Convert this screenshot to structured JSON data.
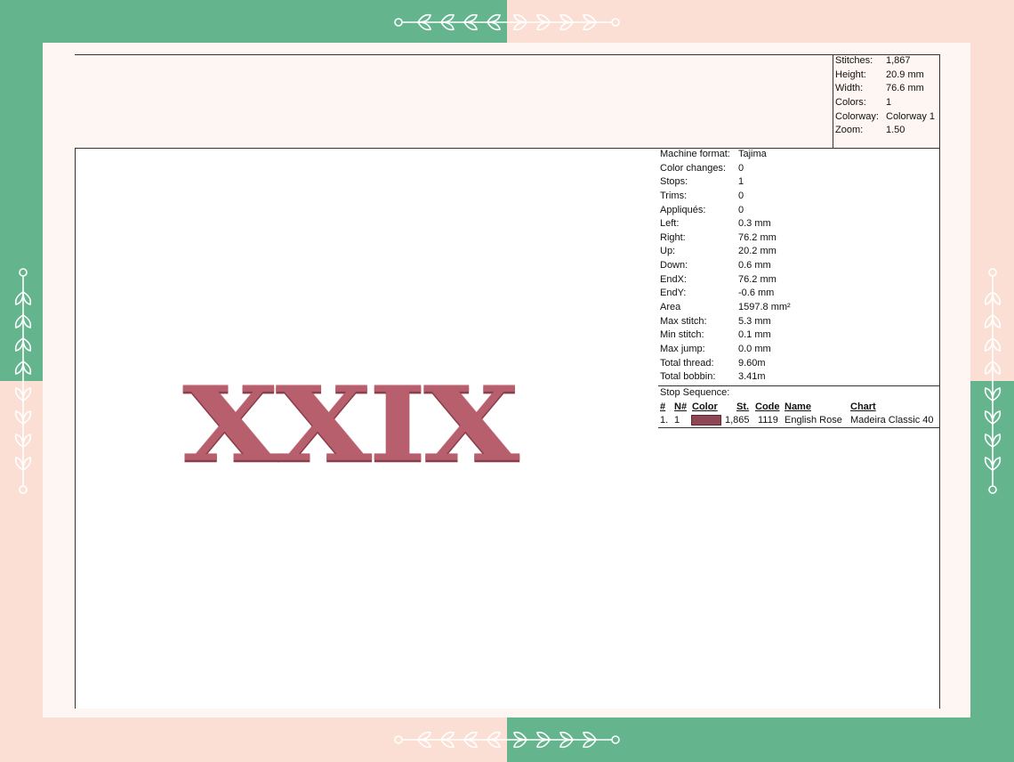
{
  "background_colors": {
    "green": "#64b48e",
    "peach": "#fbdfd4",
    "paper": "#fdf6f2"
  },
  "summary": [
    {
      "label": "Stitches:",
      "value": "1,867"
    },
    {
      "label": "Height:",
      "value": "20.9 mm"
    },
    {
      "label": "Width:",
      "value": "76.6 mm"
    },
    {
      "label": "Colors:",
      "value": "1"
    },
    {
      "label": "Colorway:",
      "value": "Colorway 1"
    },
    {
      "label": "Zoom:",
      "value": "1.50"
    }
  ],
  "design": {
    "text": "XXIX",
    "thread_color": "#b85f6e",
    "shadow_color": "#8a3f4c"
  },
  "info": [
    {
      "label": "Machine format:",
      "value": "Tajima"
    },
    {
      "label": "Color changes:",
      "value": "0"
    },
    {
      "label": "Stops:",
      "value": "1"
    },
    {
      "label": "Trims:",
      "value": "0"
    },
    {
      "label": "Appliqués:",
      "value": "0"
    },
    {
      "label": "Left:",
      "value": "0.3 mm"
    },
    {
      "label": "Right:",
      "value": "76.2 mm"
    },
    {
      "label": "Up:",
      "value": "20.2 mm"
    },
    {
      "label": "Down:",
      "value": "0.6 mm"
    },
    {
      "label": "EndX:",
      "value": "76.2 mm"
    },
    {
      "label": "EndY:",
      "value": "-0.6 mm"
    },
    {
      "label": "Area",
      "value": "1597.8 mm²"
    },
    {
      "label": "Max stitch:",
      "value": "5.3 mm"
    },
    {
      "label": "Min stitch:",
      "value": "0.1 mm"
    },
    {
      "label": "Max jump:",
      "value": "0.0 mm"
    },
    {
      "label": "Total thread:",
      "value": "9.60m"
    },
    {
      "label": "Total bobbin:",
      "value": "3.41m"
    }
  ],
  "stop_sequence": {
    "title": "Stop Sequence:",
    "headers": {
      "num": "#",
      "needle": "N#",
      "color": "Color",
      "stitches": "St.",
      "code": "Code",
      "name": "Name",
      "chart": "Chart"
    },
    "rows": [
      {
        "num": "1.",
        "needle": "1",
        "swatch": "#8e4655",
        "stitches": "1,865",
        "code": "1119",
        "name": "English Rose",
        "chart": "Madeira Classic 40"
      }
    ]
  }
}
